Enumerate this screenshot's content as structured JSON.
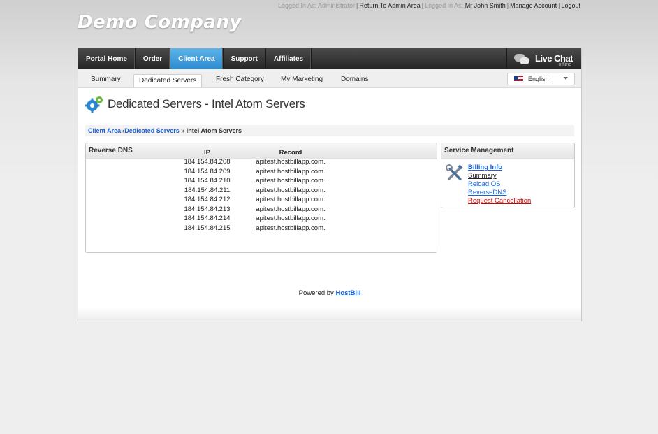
{
  "topbar": {
    "logged_admin": "Logged In As: Administrator",
    "return_admin": "Return To Admin Area",
    "logged_user_prefix": "Logged In As:",
    "user_name": "Mr John Smith",
    "manage_account": "Manage Account",
    "logout": "Logout"
  },
  "brand": {
    "logo_text": "Demo Company"
  },
  "main_nav": [
    {
      "label": "Portal Home",
      "active": false
    },
    {
      "label": "Order",
      "active": false
    },
    {
      "label": "Client Area",
      "active": true
    },
    {
      "label": "Support",
      "active": false
    },
    {
      "label": "Affiliates",
      "active": false
    }
  ],
  "live_chat": {
    "label": "Live Chat",
    "status": "offline"
  },
  "sub_nav": [
    {
      "label": "Summary",
      "active": false
    },
    {
      "label": "Dedicated Servers",
      "active": true
    },
    {
      "label": "Fresh Category",
      "active": false
    },
    {
      "label": "My Marketing",
      "active": false
    },
    {
      "label": "Domains",
      "active": false
    }
  ],
  "language": {
    "selected": "English"
  },
  "page": {
    "title": "Dedicated Servers - Intel Atom Servers"
  },
  "breadcrumb": {
    "items": [
      "Client Area",
      "Dedicated Servers"
    ],
    "separator": "»",
    "current": "Intel Atom Servers"
  },
  "reverse_dns": {
    "heading": "Reverse DNS",
    "columns": [
      "IP",
      "Record"
    ],
    "rows": [
      [
        "184.154.84.208",
        "apitest.hostbillapp.com."
      ],
      [
        "184.154.84.209",
        "apitest.hostbillapp.com."
      ],
      [
        "184.154.84.210",
        "apitest.hostbillapp.com."
      ],
      [
        "184.154.84.211",
        "apitest.hostbillapp.com."
      ],
      [
        "184.154.84.212",
        "apitest.hostbillapp.com."
      ],
      [
        "184.154.84.213",
        "apitest.hostbillapp.com."
      ],
      [
        "184.154.84.214",
        "apitest.hostbillapp.com."
      ],
      [
        "184.154.84.215",
        "apitest.hostbillapp.com."
      ]
    ]
  },
  "service_management": {
    "heading": "Service Management",
    "links": [
      {
        "label": "Billing Info",
        "style": "bold"
      },
      {
        "label": "Summary",
        "style": "black"
      },
      {
        "label": "Reload OS",
        "style": "blue"
      },
      {
        "label": "ReverseDNS",
        "style": "blue"
      },
      {
        "label": "Request Cancellation",
        "style": "red"
      }
    ]
  },
  "footer": {
    "powered_prefix": "Powered by",
    "powered_link": "HostBill"
  },
  "colors": {
    "nav_active": "#2b8bd1",
    "link": "#1a5fd6",
    "danger": "#d40000"
  }
}
